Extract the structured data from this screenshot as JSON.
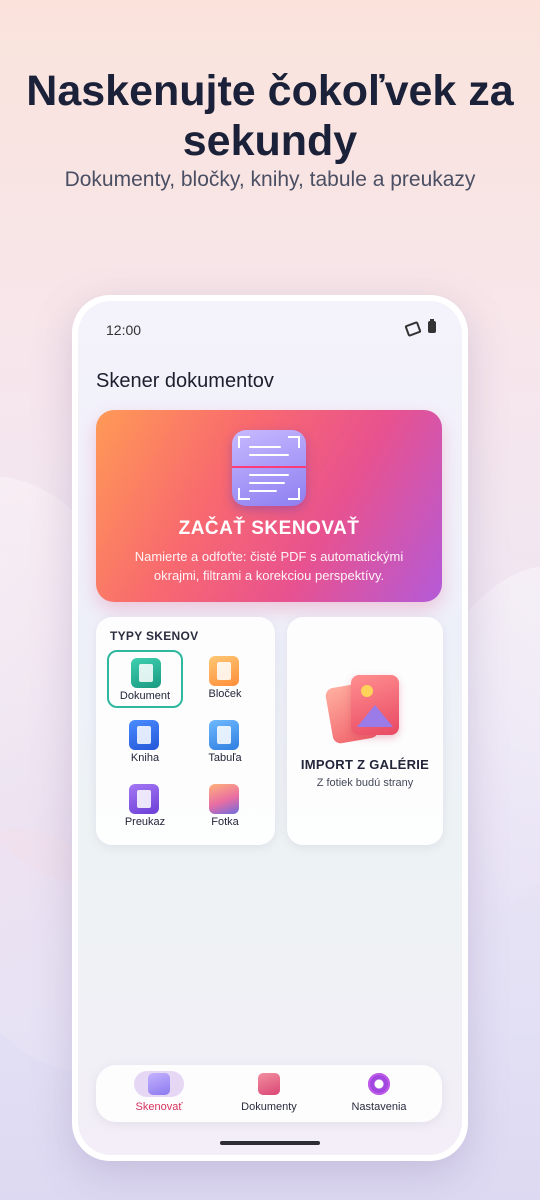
{
  "promo": {
    "headline_line1": "Naskenujte čokoľvek za",
    "headline_line2": "sekundy",
    "subline": "Dokumenty, bločky, knihy, tabule a preukazy"
  },
  "status_bar": {
    "time": "12:00",
    "icons": [
      "signal-off-icon",
      "battery-icon"
    ]
  },
  "app": {
    "title": "Skener dokumentov"
  },
  "hero": {
    "title": "ZAČAŤ SKENOVAŤ",
    "description_line1": "Namierte a odfoťte: čisté PDF s automatickými",
    "description_line2": "okrajmi, filtrami a korekciou perspektívy.",
    "icon": "document-scan-icon",
    "gradient": [
      "#ff9a56",
      "#f86a6e",
      "#e8528f",
      "#b45ad8"
    ]
  },
  "scan_types": {
    "title": "TYPY SKENOV",
    "items": [
      {
        "label": "Dokument",
        "icon": "document-icon",
        "selected": true
      },
      {
        "label": "Bloček",
        "icon": "receipt-icon",
        "selected": false
      },
      {
        "label": "Kniha",
        "icon": "book-icon",
        "selected": false
      },
      {
        "label": "Tabuľa",
        "icon": "whiteboard-icon",
        "selected": false
      },
      {
        "label": "Preukaz",
        "icon": "id-card-icon",
        "selected": false
      },
      {
        "label": "Fotka",
        "icon": "photo-icon",
        "selected": false
      }
    ],
    "selected_color": "#2fb8a0"
  },
  "import": {
    "title": "IMPORT Z GALÉRIE",
    "description": "Z fotiek budú strany",
    "icon": "gallery-icon"
  },
  "bottom_nav": {
    "items": [
      {
        "label": "Skenovať",
        "icon": "scan-icon",
        "active": true
      },
      {
        "label": "Dokumenty",
        "icon": "documents-folder-icon",
        "active": false
      },
      {
        "label": "Nastavenia",
        "icon": "settings-gear-icon",
        "active": false
      }
    ],
    "active_color": "#d6335f"
  }
}
